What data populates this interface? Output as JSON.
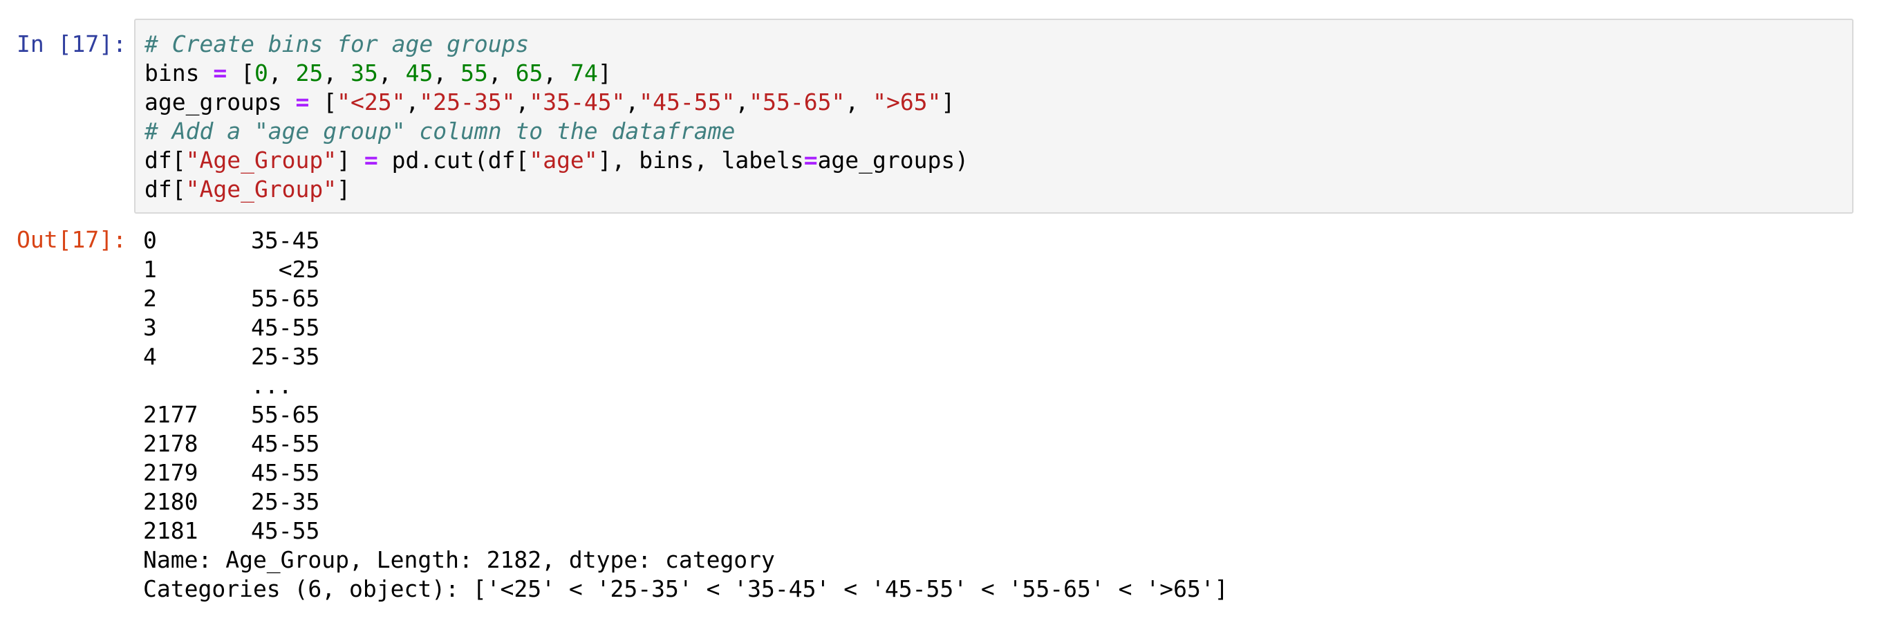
{
  "input_cell": {
    "prompt": "In [17]:",
    "lines": [
      [
        {
          "t": "# Create bins for age groups",
          "c": "cm"
        }
      ],
      [
        {
          "t": "bins "
        },
        {
          "t": "=",
          "c": "op"
        },
        {
          "t": " ["
        },
        {
          "t": "0",
          "c": "num"
        },
        {
          "t": ", "
        },
        {
          "t": "25",
          "c": "num"
        },
        {
          "t": ", "
        },
        {
          "t": "35",
          "c": "num"
        },
        {
          "t": ", "
        },
        {
          "t": "45",
          "c": "num"
        },
        {
          "t": ", "
        },
        {
          "t": "55",
          "c": "num"
        },
        {
          "t": ", "
        },
        {
          "t": "65",
          "c": "num"
        },
        {
          "t": ", "
        },
        {
          "t": "74",
          "c": "num"
        },
        {
          "t": "]"
        }
      ],
      [
        {
          "t": "age_groups "
        },
        {
          "t": "=",
          "c": "op"
        },
        {
          "t": " ["
        },
        {
          "t": "\"<25\"",
          "c": "str"
        },
        {
          "t": ","
        },
        {
          "t": "\"25-35\"",
          "c": "str"
        },
        {
          "t": ","
        },
        {
          "t": "\"35-45\"",
          "c": "str"
        },
        {
          "t": ","
        },
        {
          "t": "\"45-55\"",
          "c": "str"
        },
        {
          "t": ","
        },
        {
          "t": "\"55-65\"",
          "c": "str"
        },
        {
          "t": ", "
        },
        {
          "t": "\">65\"",
          "c": "str"
        },
        {
          "t": "]"
        }
      ],
      [
        {
          "t": "# Add a \"age group\" column to the dataframe",
          "c": "cm"
        }
      ],
      [
        {
          "t": "df["
        },
        {
          "t": "\"Age_Group\"",
          "c": "str"
        },
        {
          "t": "] "
        },
        {
          "t": "=",
          "c": "op"
        },
        {
          "t": " pd.cut(df["
        },
        {
          "t": "\"age\"",
          "c": "str"
        },
        {
          "t": "], bins, labels"
        },
        {
          "t": "=",
          "c": "op"
        },
        {
          "t": "age_groups)"
        }
      ],
      [
        {
          "t": "df["
        },
        {
          "t": "\"Age_Group\"",
          "c": "str"
        },
        {
          "t": "]"
        }
      ]
    ]
  },
  "output_cell": {
    "prompt": "Out[17]:",
    "rows": [
      {
        "index": "0",
        "value": "35-45"
      },
      {
        "index": "1",
        "value": "  <25"
      },
      {
        "index": "2",
        "value": "55-65"
      },
      {
        "index": "3",
        "value": "45-55"
      },
      {
        "index": "4",
        "value": "25-35"
      },
      {
        "index": "",
        "value": "..."
      },
      {
        "index": "2177",
        "value": "55-65"
      },
      {
        "index": "2178",
        "value": "45-55"
      },
      {
        "index": "2179",
        "value": "45-55"
      },
      {
        "index": "2180",
        "value": "25-35"
      },
      {
        "index": "2181",
        "value": "45-55"
      }
    ],
    "footer_name": "Name: Age_Group, Length: 2182, dtype: category",
    "footer_categories": "Categories (6, object): ['<25' < '25-35' < '35-45' < '45-55' < '55-65' < '>65']"
  },
  "colors": {
    "in_prompt": "#303f9f",
    "out_prompt": "#d84315",
    "comment": "#408080",
    "operator": "#aa22ff",
    "number": "#008000",
    "string": "#ba2121",
    "input_background": "#f5f5f5",
    "input_border": "#d9d9d9"
  }
}
